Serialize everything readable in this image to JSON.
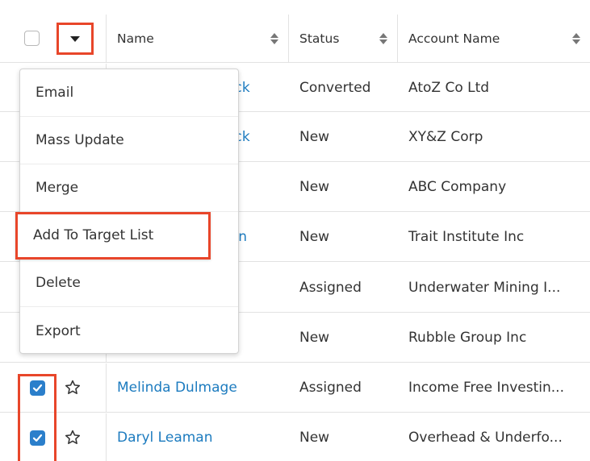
{
  "table": {
    "columns": [
      {
        "key": "name",
        "label": "Name"
      },
      {
        "key": "status",
        "label": "Status"
      },
      {
        "key": "account",
        "label": "Account Name"
      }
    ],
    "rows": [
      {
        "name": "nick",
        "status": "Converted",
        "account": "AtoZ Co Ltd",
        "checked": false
      },
      {
        "name": "nick",
        "status": "New",
        "account": "XY&Z Corp",
        "checked": false
      },
      {
        "name": "",
        "status": "New",
        "account": "ABC Company",
        "checked": false
      },
      {
        "name": "nlin",
        "status": "New",
        "account": "Trait Institute Inc",
        "checked": false
      },
      {
        "name": "",
        "status": "Assigned",
        "account": "Underwater Mining I...",
        "checked": false
      },
      {
        "name": "",
        "status": "New",
        "account": "Rubble Group Inc",
        "checked": false
      },
      {
        "name": "Melinda Dulmage",
        "status": "Assigned",
        "account": "Income Free Investin...",
        "checked": true
      },
      {
        "name": "Daryl Leaman",
        "status": "New",
        "account": "Overhead & Underfo...",
        "checked": true
      }
    ]
  },
  "actions_menu": {
    "items": [
      "Email",
      "Mass Update",
      "Merge",
      "Add To Target List",
      "Delete",
      "Export"
    ],
    "highlighted_item": "Add To Target List"
  },
  "icons": {
    "select_all": "checkbox-icon",
    "actions_toggle": "caret-down-icon",
    "sort": "sort-icon",
    "favorite": "star-icon",
    "row_checkbox": "checkbox-checked-icon"
  },
  "colors": {
    "link": "#1c7bbf",
    "highlight_border": "#e8462a",
    "checkbox_checked": "#2b7fcb"
  }
}
